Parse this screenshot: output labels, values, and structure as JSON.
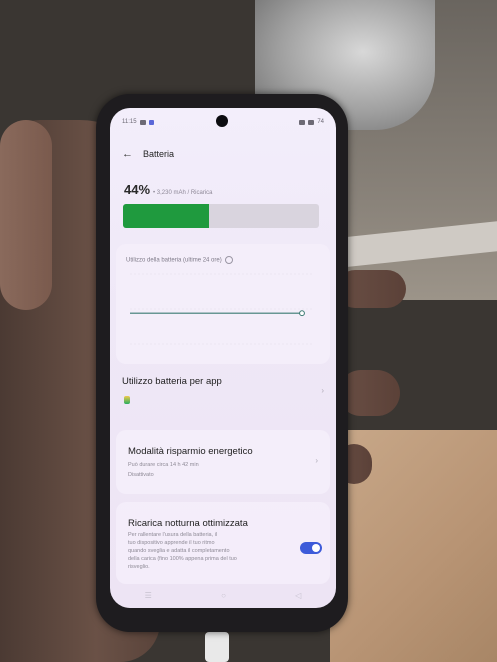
{
  "status_bar": {
    "time": "11:15",
    "battery": "74"
  },
  "header": {
    "back_icon": "arrow-left-icon",
    "title": "Batteria"
  },
  "battery": {
    "percent": "44%",
    "subtitle": "• 3,230 mAh / Ricarica",
    "level_fraction": 0.44,
    "fill_color": "#1f9a3e"
  },
  "usage": {
    "label": "Utilizzo della batteria (ultime 24 ore)",
    "chart_data": {
      "type": "line",
      "x": [
        0,
        0.2,
        0.4,
        0.6,
        0.8,
        1.0
      ],
      "series": [
        {
          "values": [
            44,
            44,
            44,
            44,
            44,
            44
          ]
        }
      ],
      "ylim": [
        0,
        100
      ],
      "xlabel": "",
      "ylabel": ""
    }
  },
  "app_usage": {
    "title": "Utilizzo batteria per app"
  },
  "power_saving": {
    "title": "Modalità risparmio energetico",
    "line1": "Può durare circa 14 h 42 min",
    "line2": "Disattivato"
  },
  "night_charge": {
    "title": "Ricarica notturna ottimizzata",
    "line1": "Per rallentare l'usura della batteria, il",
    "line2": "tuo dispositivo apprende il tuo ritmo",
    "line3": "quando sveglia e adatta il completamento",
    "line4": "della carica (fino 100% appena prima del tuo",
    "line5": "risveglio.",
    "toggle_on": true,
    "toggle_color": "#3d5bd9"
  },
  "nav": {
    "recent_icon": "recent-apps-icon",
    "home_icon": "home-icon",
    "back_icon": "back-triangle-icon"
  }
}
